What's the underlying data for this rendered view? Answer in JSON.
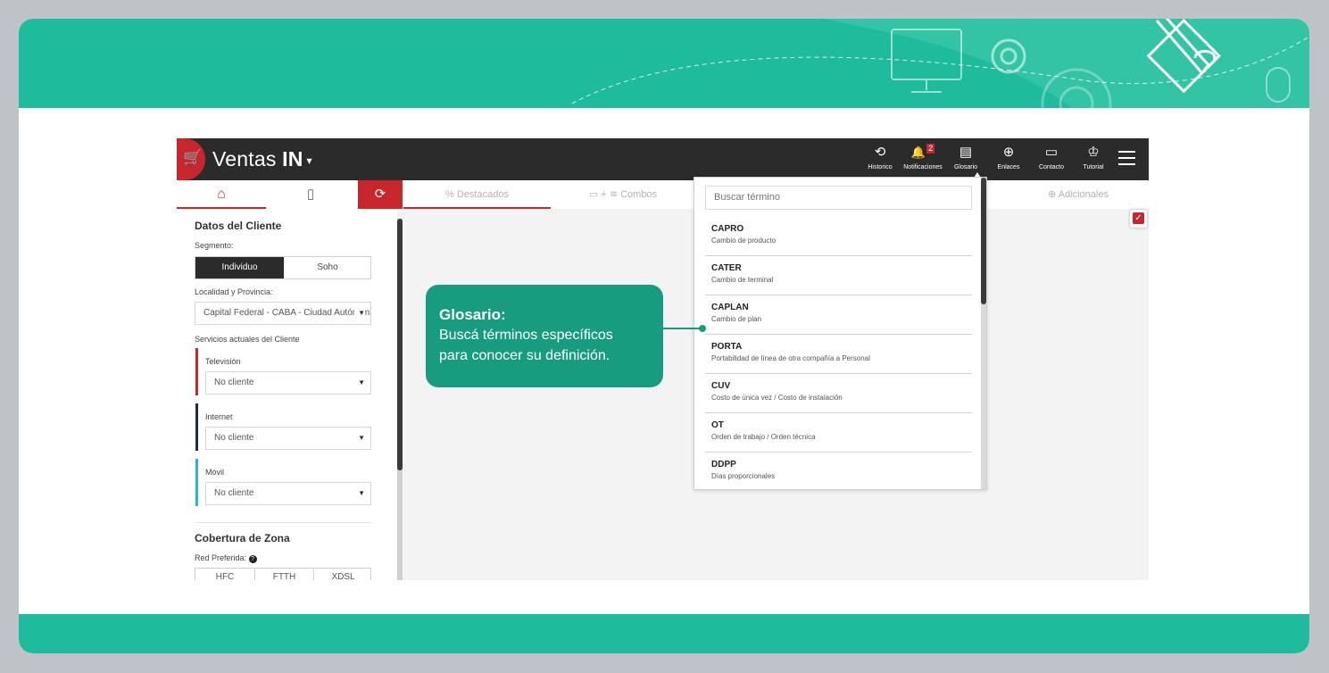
{
  "app": {
    "brand_light": "Ventas",
    "brand_bold": "IN",
    "brand_caret": "▾"
  },
  "nav": [
    {
      "label": "Historico",
      "icon": "history-icon",
      "glyph": "⟲"
    },
    {
      "label": "Notificaciones",
      "icon": "bell-icon",
      "glyph": "🔔",
      "badge": "2"
    },
    {
      "label": "Glosario",
      "icon": "book-icon",
      "glyph": "▤"
    },
    {
      "label": "Enlaces",
      "icon": "globe-icon",
      "glyph": "⊕"
    },
    {
      "label": "Contacto",
      "icon": "chat-icon",
      "glyph": "▭"
    },
    {
      "label": "Tutorial",
      "icon": "graduate-icon",
      "glyph": "♔"
    }
  ],
  "tabs": {
    "destacados": "Destacados",
    "combos": "Combos",
    "adicionales": "Adicionales"
  },
  "sidebar": {
    "title": "Datos del Cliente",
    "segmento_label": "Segmento:",
    "segment_options": [
      "Individuo",
      "Soho"
    ],
    "localidad_label": "Localidad y Provincia:",
    "localidad_value": "Capital Federal - CABA - Ciudad Autónoma",
    "servicios_label": "Servicios actuales del Cliente",
    "services": [
      {
        "label": "Televisión",
        "value": "No cliente",
        "color": "#c8262d"
      },
      {
        "label": "Internet",
        "value": "No cliente",
        "color": "#1c2b4a"
      },
      {
        "label": "Móvil",
        "value": "No cliente",
        "color": "#2bb3d6"
      }
    ],
    "cobertura_title": "Cobertura de Zona",
    "red_label": "Red Preferida:",
    "red_options": [
      "HFC",
      "FTTH",
      "XDSL"
    ]
  },
  "glossary": {
    "search_placeholder": "Buscar término",
    "items": [
      {
        "term": "CAPRO",
        "def": "Cambio de producto"
      },
      {
        "term": "CATER",
        "def": "Cambio de terminal"
      },
      {
        "term": "CAPLAN",
        "def": "Cambio de plan"
      },
      {
        "term": "PORTA",
        "def": "Portabilidad de línea de otra compañía a Personal"
      },
      {
        "term": "CUV",
        "def": "Costo de única vez / Costo de instalación"
      },
      {
        "term": "OT",
        "def": "Orden de trabajo / Orden técnica"
      },
      {
        "term": "DDPP",
        "def": "Días proporcionales"
      }
    ]
  },
  "callout": {
    "title": "Glosario:",
    "line1": "Buscá términos específicos",
    "line2": "para conocer su definición."
  },
  "colors": {
    "teal": "#1ebb9c",
    "callout": "#189c7f",
    "accent_red": "#c8262d",
    "topbar": "#2b2b2b"
  }
}
